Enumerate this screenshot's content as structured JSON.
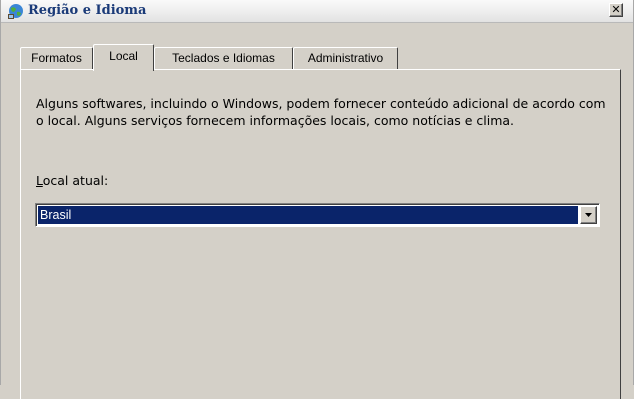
{
  "window": {
    "title": "Região e Idioma",
    "close_glyph": "✕",
    "icon": "globe-icon"
  },
  "tabs": [
    {
      "label": "Formatos",
      "active": false
    },
    {
      "label": "Local",
      "active": true
    },
    {
      "label": "Teclados e Idiomas",
      "active": false
    },
    {
      "label": "Administrativo",
      "active": false
    }
  ],
  "content": {
    "description": "Alguns softwares, incluindo o Windows, podem fornecer conteúdo adicional de acordo com o local. Alguns serviços fornecem informações locais, como notícias e clima.",
    "location_label_accel": "L",
    "location_label_rest": "ocal atual:",
    "location_value": "Brasil",
    "dropdown_icon": "chevron-down-icon"
  },
  "colors": {
    "selection": "#0a246a",
    "face": "#d4d0c8",
    "title_text": "#1a3a78"
  }
}
